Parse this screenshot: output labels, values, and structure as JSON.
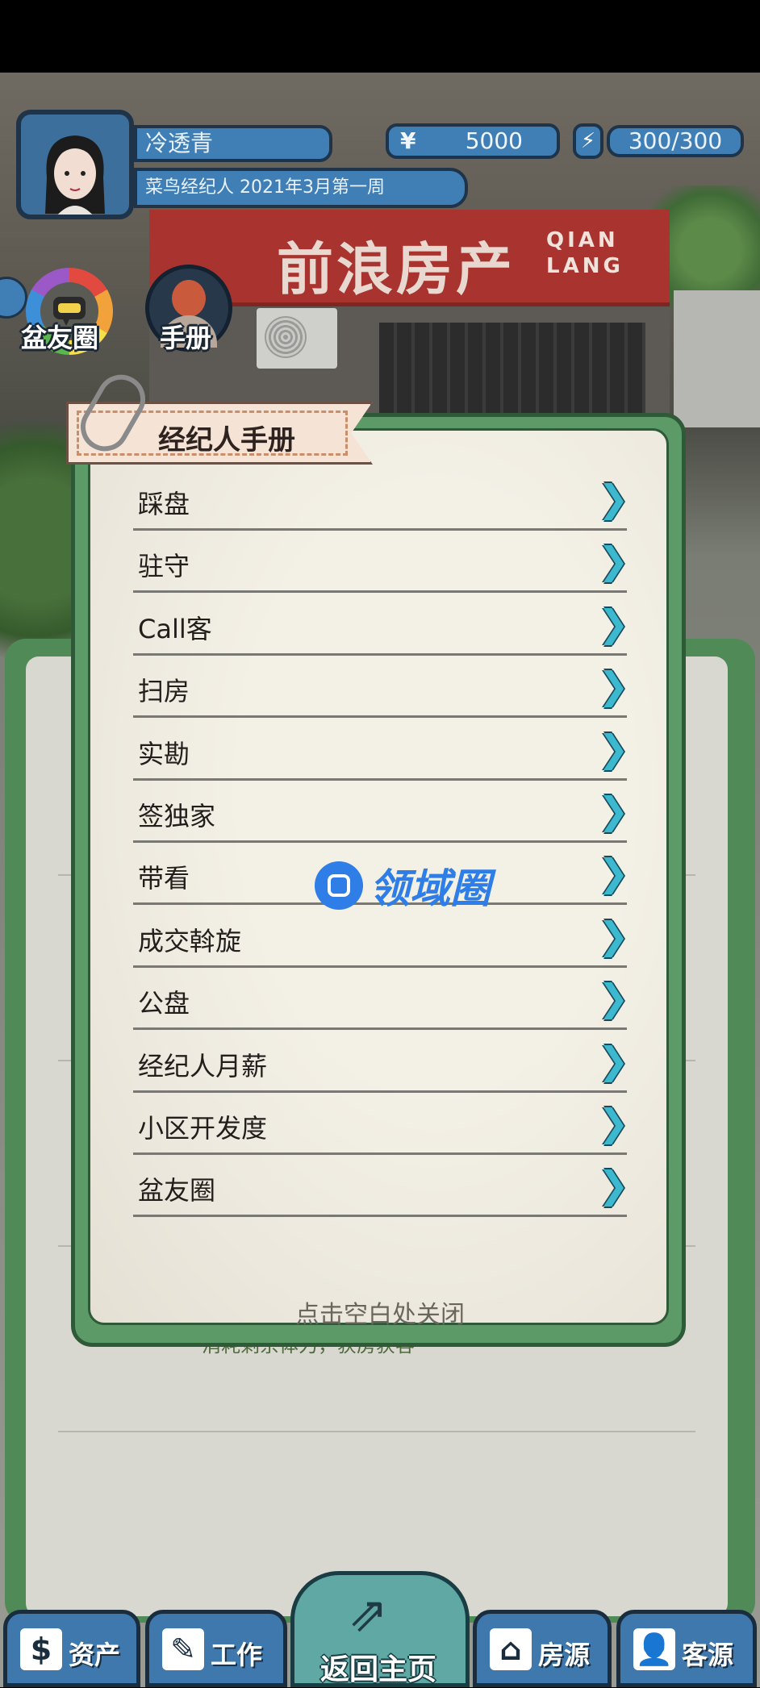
{
  "player": {
    "name": "冷透青",
    "title": "菜鸟经纪人 2021年3月第一周",
    "money_symbol": "¥",
    "money": "5000",
    "energy_symbol": "⚡",
    "energy": "300/300"
  },
  "store": {
    "sign_cn": "前浪房产",
    "sign_en_line1": "QIAN",
    "sign_en_line2": "LANG"
  },
  "side_buttons": {
    "friends_label": "盆友圈",
    "manual_label": "手册"
  },
  "background_hint": "消耗剩余体力，获房获客",
  "modal": {
    "tab_title": "经纪人手册",
    "items": [
      {
        "label": "踩盘"
      },
      {
        "label": "驻守"
      },
      {
        "label": "Call客"
      },
      {
        "label": "扫房"
      },
      {
        "label": "实勘"
      },
      {
        "label": "签独家"
      },
      {
        "label": "带看"
      },
      {
        "label": "成交斡旋"
      },
      {
        "label": "公盘"
      },
      {
        "label": "经纪人月薪"
      },
      {
        "label": "小区开发度"
      },
      {
        "label": "盆友圈"
      }
    ],
    "arrow_glyph": "❯",
    "close_hint": "点击空白处关闭"
  },
  "watermark": {
    "text": "领域圈"
  },
  "bottom_nav": {
    "assets": "资产",
    "work": "工作",
    "home": "返回主页",
    "listings": "房源",
    "clients": "客源"
  },
  "colors": {
    "hud_blue": "#3f7fb6",
    "modal_green": "#5c9b67",
    "arrow_cyan": "#3db9cf",
    "sign_red": "#a8332f"
  }
}
